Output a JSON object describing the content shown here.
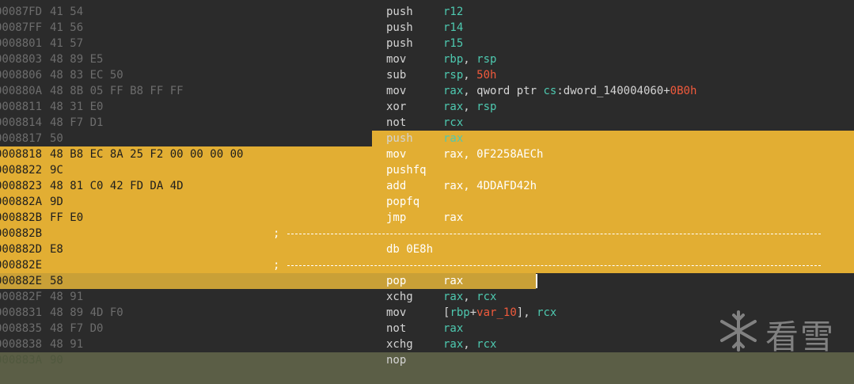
{
  "colors": {
    "background": "#2b2b2b",
    "highlight": "#e2ae33",
    "current_line": "#c9a037",
    "lower_band": "#5b5e46",
    "register": "#4ec9b0",
    "number": "#f05a3c"
  },
  "lines": [
    {
      "addr": "00087FD",
      "bytes": "41 54",
      "mnem": "push",
      "ops": "r12"
    },
    {
      "addr": "00087FF",
      "bytes": "41 56",
      "mnem": "push",
      "ops": "r14"
    },
    {
      "addr": "0008801",
      "bytes": "41 57",
      "mnem": "push",
      "ops": "r15"
    },
    {
      "addr": "0008803",
      "bytes": "48 89 E5",
      "mnem": "mov",
      "ops": "rbp, rsp"
    },
    {
      "addr": "0008806",
      "bytes": "48 83 EC 50",
      "mnem": "sub",
      "ops": "rsp, 50h"
    },
    {
      "addr": "000880A",
      "bytes": "48 8B 05 FF B8 FF FF",
      "mnem": "mov",
      "ops": "rax, qword ptr cs:dword_140004060+0B0h"
    },
    {
      "addr": "0008811",
      "bytes": "48 31 E0",
      "mnem": "xor",
      "ops": "rax, rsp"
    },
    {
      "addr": "0008814",
      "bytes": "48 F7 D1",
      "mnem": "not",
      "ops": "rcx"
    },
    {
      "addr": "0008817",
      "bytes": "50",
      "mnem": "push",
      "ops": "rax"
    },
    {
      "addr": "0008818",
      "bytes": "48 B8 EC 8A 25 F2 00 00 00 00",
      "mnem": "mov",
      "ops": "rax, 0F2258AECh"
    },
    {
      "addr": "0008822",
      "bytes": "9C",
      "mnem": "pushfq",
      "ops": ""
    },
    {
      "addr": "0008823",
      "bytes": "48 81 C0 42 FD DA 4D",
      "mnem": "add",
      "ops": "rax, 4DDAFD42h"
    },
    {
      "addr": "000882A",
      "bytes": "9D",
      "mnem": "popfq",
      "ops": ""
    },
    {
      "addr": "000882B",
      "bytes": "FF E0",
      "mnem": "jmp",
      "ops": "rax"
    },
    {
      "addr": "000882B",
      "bytes": "",
      "sep": ";",
      "mnem": "",
      "ops": ""
    },
    {
      "addr": "000882D",
      "bytes": "E8",
      "mnem": "db 0E8h",
      "ops": ""
    },
    {
      "addr": "000882E",
      "bytes": "",
      "sep": ";",
      "mnem": "",
      "ops": ""
    },
    {
      "addr": "000882E",
      "bytes": "58",
      "mnem": "pop",
      "ops": "rax"
    },
    {
      "addr": "000882F",
      "bytes": "48 91",
      "mnem": "xchg",
      "ops": "rax, rcx"
    },
    {
      "addr": "0008831",
      "bytes": "48 89 4D F0",
      "mnem": "mov",
      "ops": "[rbp+var_10], rcx"
    },
    {
      "addr": "0008835",
      "bytes": "48 F7 D0",
      "mnem": "not",
      "ops": "rax"
    },
    {
      "addr": "0008838",
      "bytes": "48 91",
      "mnem": "xchg",
      "ops": "rax, rcx"
    },
    {
      "addr": "000883A",
      "bytes": "90",
      "mnem": "nop",
      "ops": ""
    }
  ],
  "watermark": {
    "text": "看雪"
  }
}
